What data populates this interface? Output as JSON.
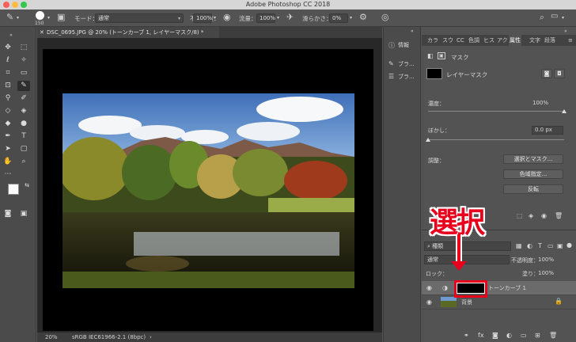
{
  "app": {
    "title": "Adobe Photoshop CC 2018"
  },
  "options": {
    "brush_size": "150",
    "mode_label": "モード：",
    "mode_value": "通常",
    "opacity_label": "不透明度：",
    "opacity_value": "100%",
    "flow_label": "流量：",
    "flow_value": "100%",
    "smoothing_label": "滑らかさ：",
    "smoothing_value": "0%"
  },
  "document": {
    "tab_title": "DSC_0695.JPG @ 20% (トーンカーブ 1, レイヤーマスク/8) *",
    "zoom": "20%",
    "profile": "sRGB IEC61966-2.1 (8bpc)"
  },
  "mid_panel": {
    "info": "情報",
    "brush1": "ブラ...",
    "brush2": "ブラ..."
  },
  "right_tabs": [
    "カラ",
    "スウ",
    "CC",
    "色調",
    "ヒス",
    "アク",
    "属性",
    "文字",
    "段落"
  ],
  "properties": {
    "title": "マスク",
    "mask_label": "レイヤーマスク",
    "density_label": "濃度：",
    "density_value": "100%",
    "feather_label": "ぼかし：",
    "feather_value": "0.0 px",
    "adjust_label": "調整：",
    "select_mask_btn": "選択とマスク...",
    "color_range_btn": "色域指定...",
    "invert_btn": "反転",
    "density_fraction": 1.0,
    "feather_fraction": 0.0
  },
  "layers_panel": {
    "kind_label": "種類",
    "blend_mode": "通常",
    "opacity_label": "不透明度：",
    "opacity_value": "100%",
    "lock_label": "ロック：",
    "fill_label": "塗り：",
    "fill_value": "100%",
    "layers": [
      {
        "name": "トーンカーブ 1"
      },
      {
        "name": "背景"
      }
    ]
  },
  "annotation": {
    "callout": "選択"
  },
  "colors": {
    "accent_red": "#e8001c",
    "panel_bg": "#535353",
    "canvas_bg": "#282828",
    "selected_tab": "#535353"
  }
}
